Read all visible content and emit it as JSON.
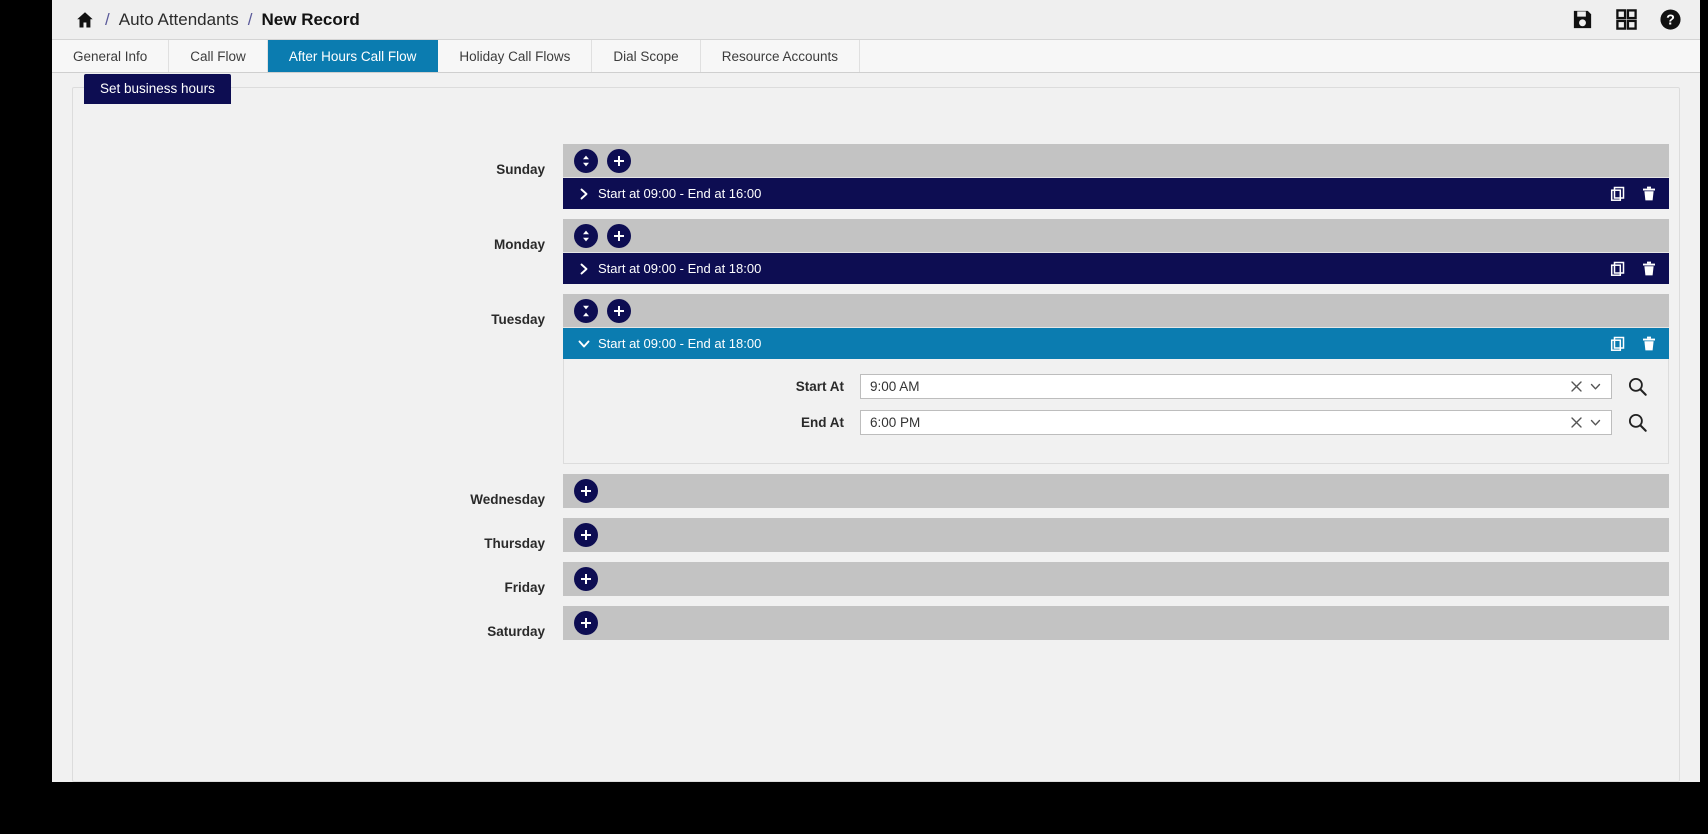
{
  "header": {
    "home_icon": "home-icon",
    "separator": "/",
    "breadcrumb_parent": "Auto Attendants",
    "breadcrumb_current": "New Record",
    "actions": [
      {
        "name": "save-icon",
        "title": "Save"
      },
      {
        "name": "apps-grid-icon",
        "title": "Apps"
      },
      {
        "name": "help-icon",
        "title": "Help"
      }
    ]
  },
  "tabs": [
    {
      "label": "General Info",
      "active": false
    },
    {
      "label": "Call Flow",
      "active": false
    },
    {
      "label": "After Hours Call Flow",
      "active": true
    },
    {
      "label": "Holiday Call Flows",
      "active": false
    },
    {
      "label": "Dial Scope",
      "active": false
    },
    {
      "label": "Resource Accounts",
      "active": false
    }
  ],
  "panel": {
    "legend": "Set business hours"
  },
  "days": [
    {
      "label": "Sunday",
      "toolbar_icons": [
        "expand-collapse-icon",
        "add-icon"
      ],
      "entries": [
        {
          "title": "Start at 09:00 - End at 16:00",
          "state": "collapsed",
          "actions": [
            "copy-icon",
            "delete-icon"
          ]
        }
      ]
    },
    {
      "label": "Monday",
      "toolbar_icons": [
        "expand-collapse-icon",
        "add-icon"
      ],
      "entries": [
        {
          "title": "Start at 09:00 - End at 18:00",
          "state": "collapsed",
          "actions": [
            "copy-icon",
            "delete-icon"
          ]
        }
      ]
    },
    {
      "label": "Tuesday",
      "toolbar_icons": [
        "collapse-all-icon",
        "add-icon"
      ],
      "entries": [
        {
          "title": "Start at 09:00 - End at 18:00",
          "state": "expanded",
          "actions": [
            "copy-icon",
            "delete-icon"
          ],
          "fields": [
            {
              "label": "Start At",
              "value": "9:00 AM",
              "clear_icon": "clear-icon",
              "dropdown_icon": "chevron-down-icon",
              "search_icon": "search-icon"
            },
            {
              "label": "End At",
              "value": "6:00 PM",
              "clear_icon": "clear-icon",
              "dropdown_icon": "chevron-down-icon",
              "search_icon": "search-icon"
            }
          ]
        }
      ]
    },
    {
      "label": "Wednesday",
      "toolbar_icons": [
        "add-icon"
      ],
      "entries": []
    },
    {
      "label": "Thursday",
      "toolbar_icons": [
        "add-icon"
      ],
      "entries": []
    },
    {
      "label": "Friday",
      "toolbar_icons": [
        "add-icon"
      ],
      "entries": []
    },
    {
      "label": "Saturday",
      "toolbar_icons": [
        "add-icon"
      ],
      "entries": []
    }
  ],
  "colors": {
    "accent_blue": "#0b7cb0",
    "navy": "#0d0d52",
    "toolbar_grey": "#c3c3c3",
    "page_bg": "#f1f1f1"
  }
}
